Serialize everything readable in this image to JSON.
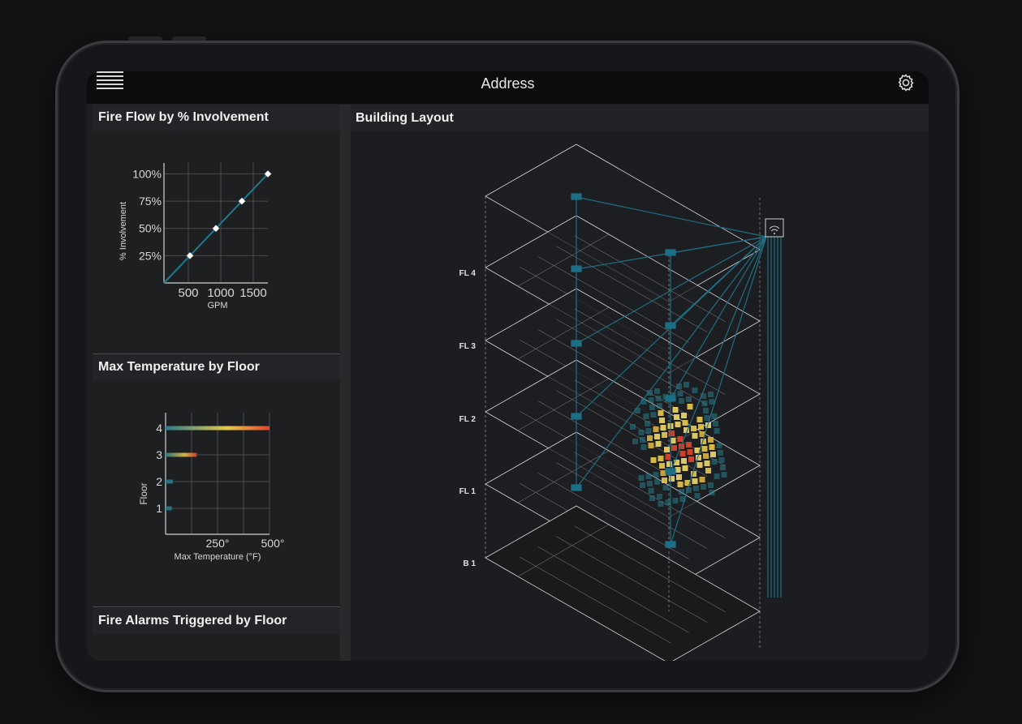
{
  "header": {
    "title": "Address"
  },
  "panels": {
    "fire_flow": {
      "title": "Fire Flow by % Involvement"
    },
    "max_temp": {
      "title": "Max Temperature by Floor"
    },
    "alarms": {
      "title": "Fire Alarms Triggered by Floor"
    },
    "building": {
      "title": "Building Layout"
    }
  },
  "floors": [
    "FL 4",
    "FL 3",
    "FL 2",
    "FL 1",
    "B 1"
  ],
  "chart_data": [
    {
      "type": "line",
      "title": "Fire Flow by % Involvement",
      "xlabel": "GPM",
      "ylabel": "% Involvement",
      "x_ticks": [
        "500",
        "1000",
        "1500"
      ],
      "y_ticks": [
        "25%",
        "50%",
        "75%",
        "100%"
      ],
      "xlim": [
        0,
        1600
      ],
      "ylim": [
        0,
        110
      ],
      "series": [
        {
          "x": [
            400,
            800,
            1200,
            1600
          ],
          "y": [
            25,
            50,
            75,
            100
          ]
        }
      ]
    },
    {
      "type": "bar",
      "title": "Max Temperature by Floor",
      "xlabel": "Max Temperature (°F)",
      "ylabel": "Floor",
      "categories": [
        "1",
        "2",
        "3",
        "4"
      ],
      "values": [
        30,
        35,
        150,
        500
      ],
      "x_ticks": [
        "250°",
        "500°"
      ],
      "xlim": [
        0,
        500
      ],
      "colors": [
        "#2a7e8c",
        "#e8c94a",
        "#e0452b"
      ]
    }
  ]
}
